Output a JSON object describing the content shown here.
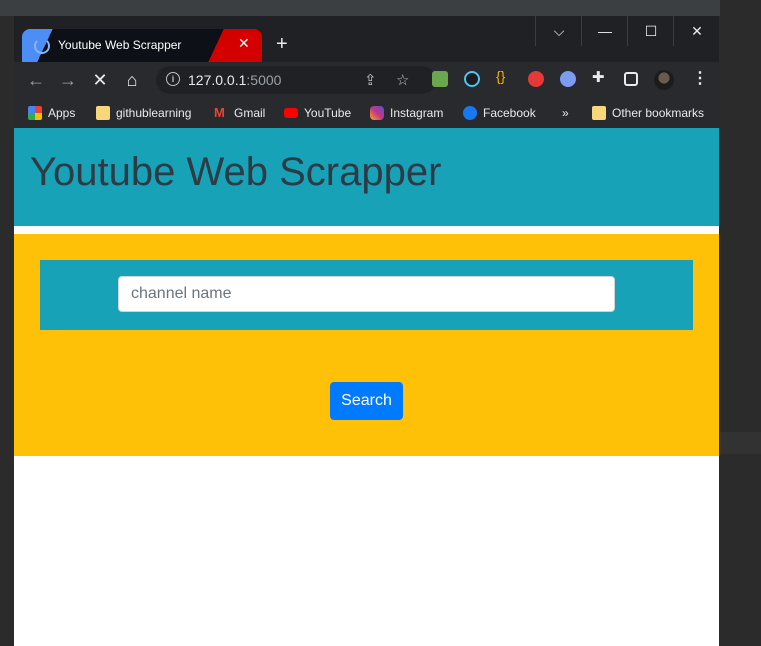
{
  "browser": {
    "tab_title": "Youtube Web Scrapper",
    "tab_close": "✕",
    "new_tab": "+",
    "url_host": "127.0.0.1",
    "url_port": ":5000",
    "window_controls": [
      "⌵",
      "—",
      "☐",
      "✕"
    ]
  },
  "bookmarks": {
    "items": [
      {
        "label": "Apps",
        "icon": "apps-grid-icon",
        "color": "#ea4335"
      },
      {
        "label": "githublearning",
        "icon": "folder-icon",
        "color": "#f6d87a"
      },
      {
        "label": "Gmail",
        "icon": "gmail-icon",
        "color": "#ea4335"
      },
      {
        "label": "YouTube",
        "icon": "youtube-icon",
        "color": "#ff0000"
      },
      {
        "label": "Instagram",
        "icon": "instagram-icon",
        "color": "#c13584"
      },
      {
        "label": "Facebook",
        "icon": "facebook-icon",
        "color": "#1877f2"
      }
    ],
    "overflow": "»",
    "other": "Other bookmarks"
  },
  "page": {
    "title": "Youtube Web Scrapper",
    "search_placeholder": "channel name",
    "search_button": "Search",
    "colors": {
      "header": "#17a2b8",
      "panel": "#ffc107",
      "button": "#007bff"
    }
  }
}
